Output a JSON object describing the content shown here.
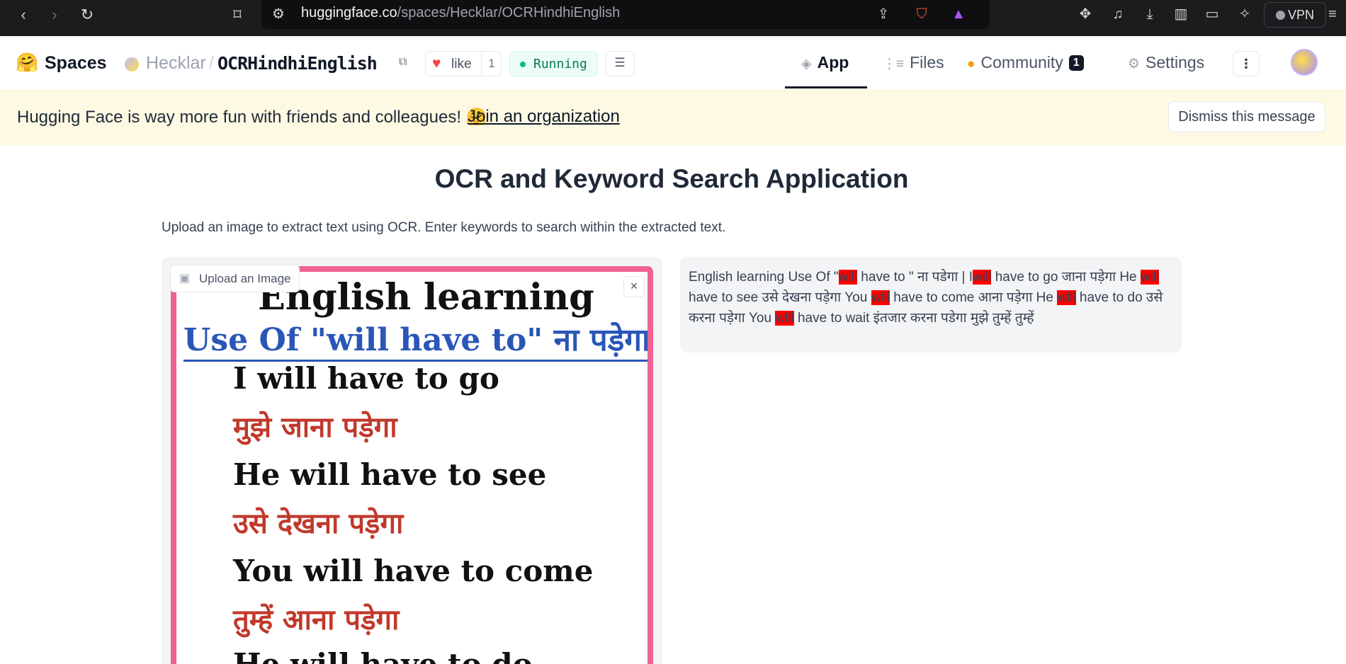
{
  "browser": {
    "url_host": "huggingface.co",
    "url_path": "/spaces/Hecklar/OCRHindhiEnglish",
    "vpn_label": "VPN",
    "icons": [
      "back-icon",
      "forward-icon",
      "reload-icon",
      "bookmark-icon",
      "site-settings-icon",
      "share-icon",
      "brave-shield-icon",
      "brave-rewards-icon",
      "extensions-icon",
      "media-icon",
      "download-icon",
      "sidebar-icon",
      "wallet-icon",
      "leo-ai-icon",
      "menu-icon"
    ]
  },
  "header": {
    "logo": "🤗",
    "spaces_label": "Spaces",
    "owner": "Hecklar",
    "separator": "/",
    "repo": "OCRHindhiEnglish",
    "like_label": "like",
    "like_count": "1",
    "status": "Running",
    "tabs": [
      {
        "label": "App",
        "icon": "cube-icon"
      },
      {
        "label": "Files",
        "icon": "files-icon"
      },
      {
        "label": "Community",
        "icon": "community-icon",
        "badge": "1"
      },
      {
        "label": "Settings",
        "icon": "gear-icon"
      }
    ]
  },
  "banner": {
    "text": "Hugging Face is way more fun with friends and colleagues! 🤗",
    "link": "Join an organization",
    "dismiss": "Dismiss this message"
  },
  "app": {
    "title": "OCR and Keyword Search Application",
    "description": "Upload an image to extract text using OCR. Enter keywords to search within the extracted text.",
    "upload_label": "Upload an Image",
    "image_lines": [
      "English learning",
      "Use Of \"will have to\" ना पड़ेगा।",
      "I will have to go",
      "मुझे जाना पड़ेगा",
      "He will have to see",
      "उसे देखना पड़ेगा",
      "You will have to come",
      "तुम्हें आना पड़ेगा",
      "He will have to do"
    ],
    "output": {
      "keyword": "will",
      "segments": [
        "English learning Use Of \"",
        " have to \" ना पडेगा | I",
        " have to go जाना पड़ेगा He ",
        " have to see उसे देखना पड़ेगा You ",
        " have to come आना पड़ेगा He ",
        " have to do उसे करना पड़ेगा You ",
        " have to wait इंतजार करना पडेगा मुझे तुम्हें तुम्हें"
      ]
    }
  },
  "colors": {
    "banner_bg": "#fef9e3",
    "highlight": "#ff0000",
    "running_green": "#10b981",
    "image_border": "#f06292"
  }
}
